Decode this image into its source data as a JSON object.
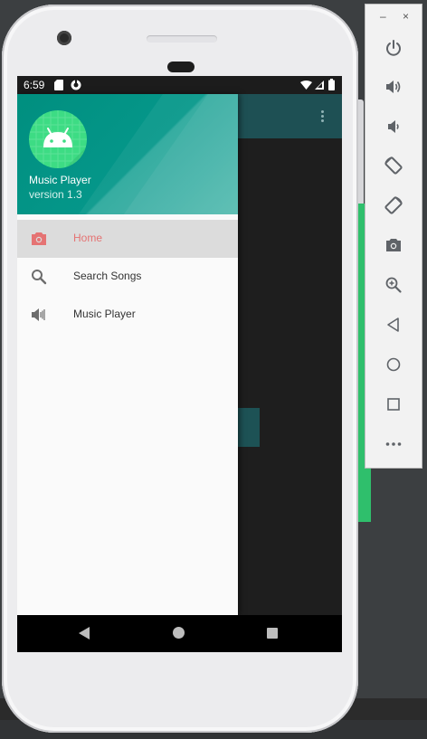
{
  "status_bar": {
    "time": "6:59",
    "icons": [
      "sd-card-icon",
      "sync-icon",
      "wifi-icon",
      "signal-icon",
      "battery-icon"
    ]
  },
  "drawer": {
    "header": {
      "app_name": "Music Player",
      "version": "version 1.3",
      "accent_color": "#009688"
    },
    "items": [
      {
        "label": "Home",
        "icon": "camera-icon",
        "selected": true
      },
      {
        "label": "Search Songs",
        "icon": "search-icon",
        "selected": false
      },
      {
        "label": "Music Player",
        "icon": "speaker-icon",
        "selected": false
      }
    ],
    "selected_color": "#e57373"
  },
  "nav_bar": {
    "buttons": [
      "back-icon",
      "home-icon",
      "recents-icon"
    ]
  },
  "emulator_panel": {
    "window_controls": [
      "minimize",
      "close"
    ],
    "window_control_labels": {
      "minimize": "–",
      "close": "×"
    },
    "buttons": [
      "power",
      "volume-up",
      "volume-down",
      "rotate-left",
      "rotate-right",
      "screenshot",
      "zoom",
      "back",
      "home",
      "overview",
      "more"
    ]
  }
}
